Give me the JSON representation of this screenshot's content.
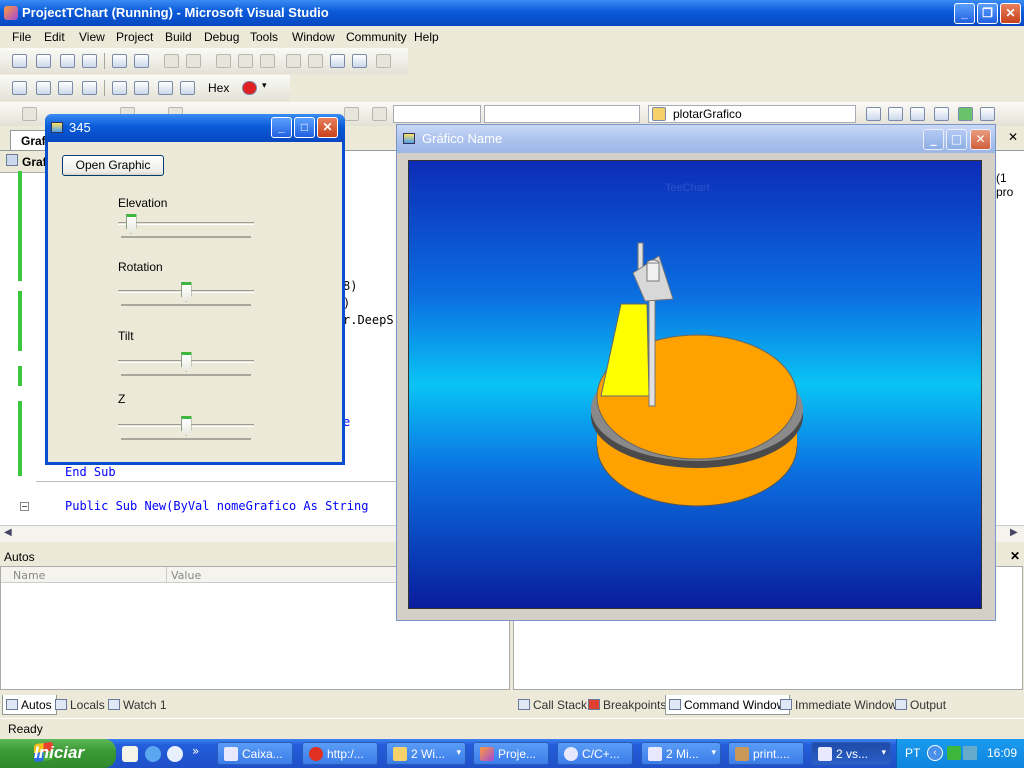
{
  "ide": {
    "title": "ProjectTChart (Running) - Microsoft Visual Studio",
    "menu": [
      "File",
      "Edit",
      "View",
      "Project",
      "Build",
      "Debug",
      "Tools",
      "Window",
      "Community",
      "Help"
    ],
    "toolbar_hex": "Hex",
    "method_combo": "plotarGrafico",
    "doc_tab": "Grafi",
    "doc_tab2": "Graf",
    "code": {
      "frag1": "8)",
      "frag2": ")",
      "frag3": "r.DeepS",
      "frag4": "e",
      "end_sub": "End Sub",
      "public_sub": "Public Sub New(ByVal nomeGrafico As String",
      "right_frag": "(1 pro"
    },
    "autos": {
      "title": "Autos",
      "col_name": "Name",
      "col_value": "Value"
    },
    "bottom_tabs_left": [
      "Autos",
      "Locals",
      "Watch 1"
    ],
    "bottom_tabs_right": [
      "Call Stack",
      "Breakpoints",
      "Command Window",
      "Immediate Window",
      "Output"
    ],
    "status": "Ready"
  },
  "win345": {
    "title": "345",
    "open_button": "Open Graphic",
    "sliders": [
      {
        "label": "Elevation",
        "value": 0.06
      },
      {
        "label": "Rotation",
        "value": 0.5
      },
      {
        "label": "Tilt",
        "value": 0.5
      },
      {
        "label": "Z",
        "value": 0.5
      }
    ]
  },
  "chartwin": {
    "title": "Gráfico Name",
    "chart_title": "TeeChart"
  },
  "taskbar": {
    "start": "Iniciar",
    "items": [
      "Caixa...",
      "http:/...",
      "2 Wi...",
      "Proje...",
      "C/C+...",
      "2 Mi...",
      "print....",
      "2 vs..."
    ],
    "lang": "PT",
    "clock": "16:09"
  },
  "colors": {
    "xp_blue": "#0a5ad9",
    "pie_orange": "#ffa200",
    "pie_yellow": "#ffff00"
  }
}
